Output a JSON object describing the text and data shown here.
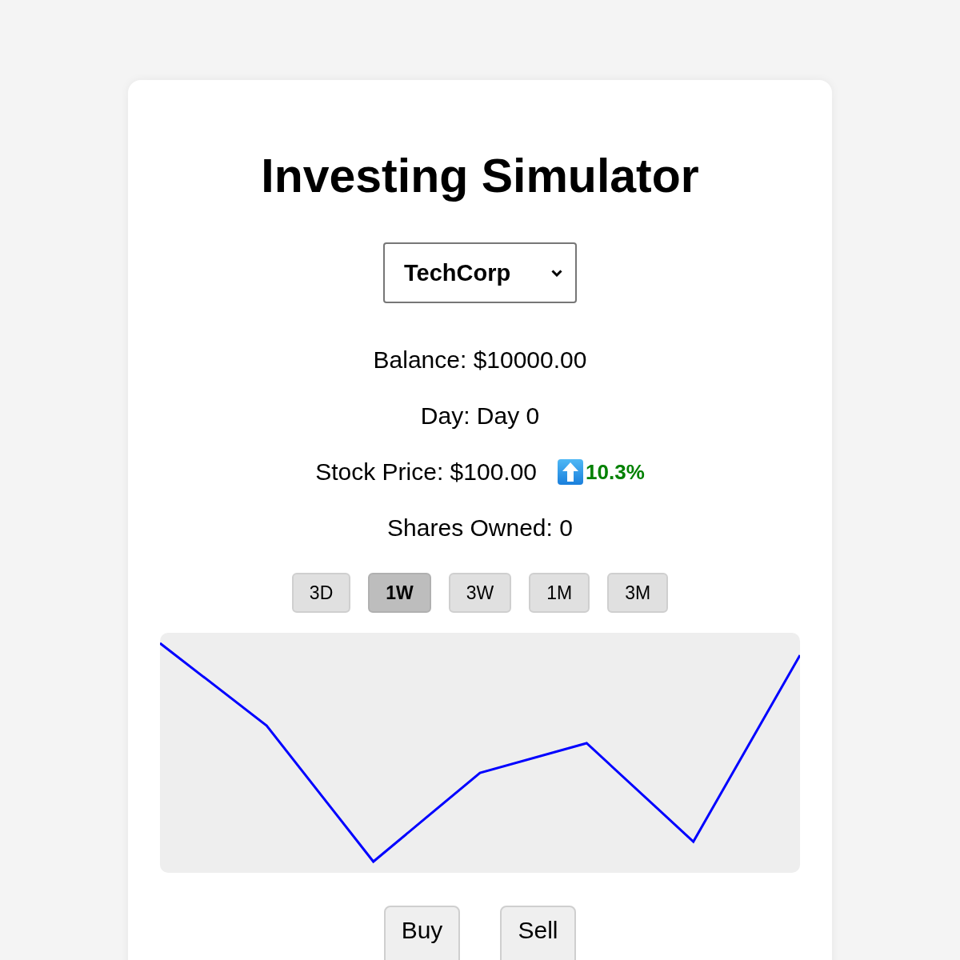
{
  "title": "Investing Simulator",
  "stock_select": {
    "value": "TechCorp"
  },
  "stats": [
    {
      "text": "Balance: $10000.00"
    },
    {
      "text": "Day: Day 0"
    },
    {
      "text": "Stock Price: $100.00",
      "change": {
        "up": true,
        "text": "10.3%"
      }
    },
    {
      "text": "Shares Owned: 0"
    }
  ],
  "ranges": [
    {
      "label": "3D",
      "selected": false
    },
    {
      "label": "1W",
      "selected": true
    },
    {
      "label": "3W",
      "selected": false
    },
    {
      "label": "1M",
      "selected": false
    },
    {
      "label": "3M",
      "selected": false
    }
  ],
  "actions": [
    "Buy",
    "Sell"
  ]
}
